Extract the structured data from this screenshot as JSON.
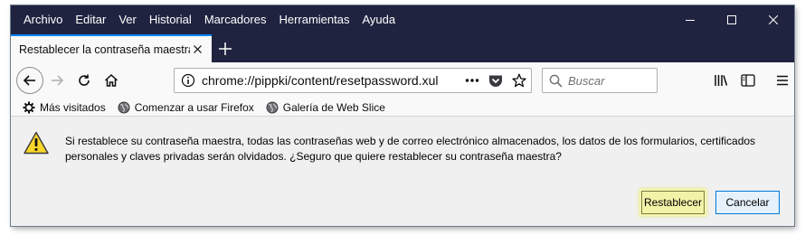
{
  "menubar": {
    "items": [
      "Archivo",
      "Editar",
      "Ver",
      "Historial",
      "Marcadores",
      "Herramientas",
      "Ayuda"
    ]
  },
  "tab": {
    "title": "Restablecer la contraseña maestra"
  },
  "urlbar": {
    "url": "chrome://pippki/content/resetpassword.xul"
  },
  "search": {
    "placeholder": "Buscar"
  },
  "bookmarks": [
    {
      "label": "Más visitados",
      "icon": "gear-icon"
    },
    {
      "label": "Comenzar a usar Firefox",
      "icon": "globe-icon"
    },
    {
      "label": "Galería de Web Slice",
      "icon": "globe-icon"
    }
  ],
  "dialog": {
    "message": "Si restablece su contraseña maestra, todas las contraseñas web y de correo electrónico almacenados, los datos de los formularios, certificados personales y claves privadas serán olvidados. ¿Seguro que quiere restablecer su contraseña maestra?",
    "reset_label": "Restablecer",
    "cancel_label": "Cancelar"
  },
  "colors": {
    "titlebar": "#202340",
    "tab_accent": "#0a84ff",
    "reset_highlight": "#f3f3a8"
  }
}
